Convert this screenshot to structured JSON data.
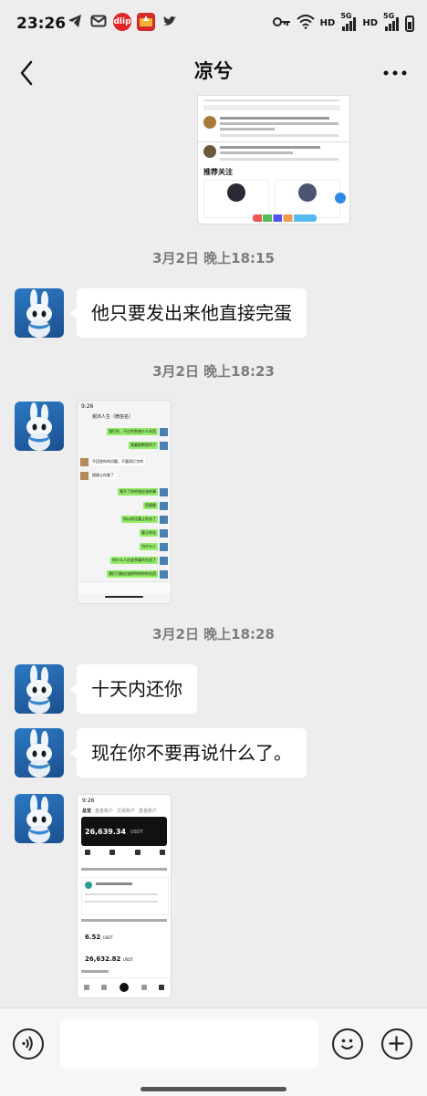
{
  "status_bar": {
    "time": "23:26",
    "left_icons": [
      "telegram-icon",
      "mail-icon",
      "app-icon-dlip",
      "app-icon-red",
      "twitter-icon"
    ],
    "dlip_label": "dlip",
    "hd1": "HD",
    "sig1": "5G",
    "hd2": "HD",
    "sig2": "5G"
  },
  "nav": {
    "title": "凉兮"
  },
  "messages": {
    "ts1": "3月2日 晚上18:15",
    "msg1": "他只要发出来他直接完蛋",
    "ts2": "3月2日 晚上18:23",
    "ts3": "3月2日 晚上18:28",
    "msg2": "十天内还你",
    "msg3": "现在你不要再说什么了。"
  },
  "img1": {
    "recommend": "推荐关注"
  },
  "img2": {
    "header_time": "9:26",
    "header_title": "谢沐人生（微信名）",
    "chat_lines": [
      {
        "side": "right",
        "text": "我们你，不过你到底什么东西"
      },
      {
        "side": "right",
        "text": "我要报警提供了"
      },
      {
        "side": "left",
        "text": "不回答你的问题，不要再打字的"
      },
      {
        "side": "left",
        "text": "随便让你要了"
      },
      {
        "side": "right",
        "text": "我不了你的钱应该的事"
      },
      {
        "side": "right",
        "text": "您随便"
      },
      {
        "side": "right",
        "text": "所以你还要让你去了"
      },
      {
        "side": "right",
        "text": "要让你去"
      },
      {
        "side": "right",
        "text": "为什么人"
      },
      {
        "side": "right",
        "text": "你什么人应该多要的东西了"
      },
      {
        "side": "right",
        "text": "我们可能应该把你的你的东西"
      }
    ]
  },
  "img3": {
    "header_time": "9:26",
    "tabs": [
      "总览",
      "基金账户",
      "交易账户",
      "基金账户"
    ],
    "balance": "26,639.34",
    "balance_unit": "USDT",
    "value1": "6.52",
    "value1_unit": "USDT",
    "value2": "26,632.82",
    "value2_unit": "USDT"
  },
  "colors": {
    "bg": "#ededed",
    "bubble": "#ffffff",
    "wechat_green": "#95ec69",
    "avatar_blue": "#2c79c4"
  }
}
